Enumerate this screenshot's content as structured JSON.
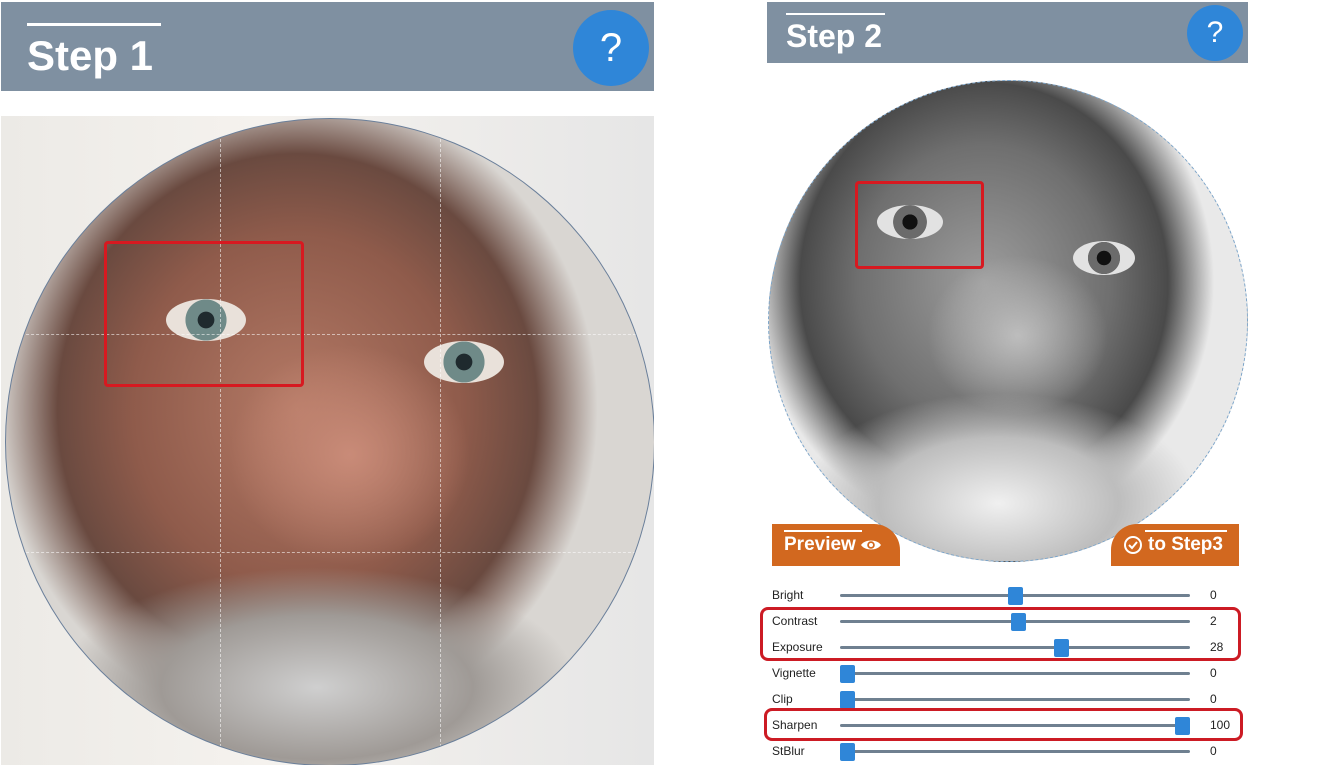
{
  "step1": {
    "title": "Step 1",
    "help": "?"
  },
  "step2": {
    "title": "Step 2",
    "help": "?"
  },
  "buttons": {
    "preview": "Preview",
    "to_step3": "to Step3"
  },
  "icons": {
    "preview": "eye-icon",
    "to_step3": "check-circle-icon"
  },
  "sliders": [
    {
      "label": "Bright",
      "value": "0",
      "fraction": 0.5
    },
    {
      "label": "Contrast",
      "value": "2",
      "fraction": 0.51
    },
    {
      "label": "Exposure",
      "value": "28",
      "fraction": 0.64
    },
    {
      "label": "Vignette",
      "value": "0",
      "fraction": 0.0
    },
    {
      "label": "Clip",
      "value": "0",
      "fraction": 0.0
    },
    {
      "label": "Sharpen",
      "value": "100",
      "fraction": 1.0
    },
    {
      "label": "StBlur",
      "value": "0",
      "fraction": 0.0
    }
  ],
  "colors": {
    "header": "#7f90a1",
    "help": "#2f86d8",
    "button": "#d2681f",
    "highlight": "#d71920",
    "knob": "#2f86d8"
  }
}
